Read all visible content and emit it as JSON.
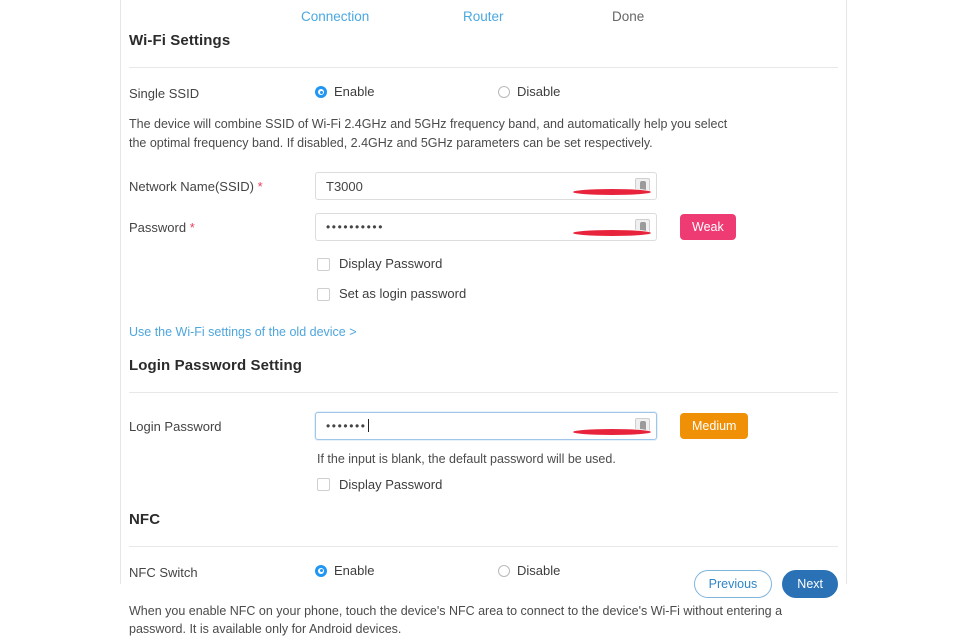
{
  "wizard": {
    "steps": [
      {
        "label": "Connection",
        "state": "done"
      },
      {
        "label": "Router",
        "state": "current"
      },
      {
        "label": "Done",
        "state": "todo"
      }
    ]
  },
  "wifi_section": {
    "title": "Wi-Fi Settings",
    "single_ssid": {
      "label": "Single SSID",
      "enable_label": "Enable",
      "disable_label": "Disable",
      "selected": "Enable",
      "description": "The device will combine SSID of Wi-Fi 2.4GHz and 5GHz frequency band, and automatically help you select the optimal frequency band. If disabled, 2.4GHz and 5GHz parameters can be set respectively."
    },
    "ssid_field": {
      "label": "Network Name(SSID)",
      "required_mark": "*",
      "value": "T3000",
      "placeholder": "",
      "icon": "password-manager-icon"
    },
    "password_field": {
      "label": "Password",
      "required_mark": "*",
      "value": "••••••••••",
      "masked_length": 10,
      "placeholder": "",
      "icon": "password-manager-icon",
      "strength_badge": "Weak",
      "strength_color": "#ef3b74"
    },
    "display_password_checkbox": {
      "label": "Display Password",
      "checked": false
    },
    "set_as_login_password_checkbox": {
      "label": "Set as login password",
      "checked": false
    },
    "old_device_link": "Use the Wi-Fi settings of the old device >"
  },
  "login_section": {
    "title": "Login Password Setting",
    "login_password_field": {
      "label": "Login Password",
      "value": "•••••••",
      "masked_length": 7,
      "placeholder": "",
      "focused": true,
      "icon": "password-manager-icon",
      "strength_badge": "Medium",
      "strength_color": "#ef9007"
    },
    "hint": "If the input is blank, the default password will be used.",
    "display_password_checkbox": {
      "label": "Display Password",
      "checked": false
    }
  },
  "nfc_section": {
    "title": "NFC",
    "nfc_switch": {
      "label": "NFC Switch",
      "enable_label": "Enable",
      "disable_label": "Disable",
      "selected": "Enable"
    },
    "description": "When you enable NFC on your phone, touch the device's NFC area to connect to the device's Wi-Fi without entering a password. It is available only for Android devices."
  },
  "footer": {
    "previous_label": "Previous",
    "next_label": "Next"
  }
}
